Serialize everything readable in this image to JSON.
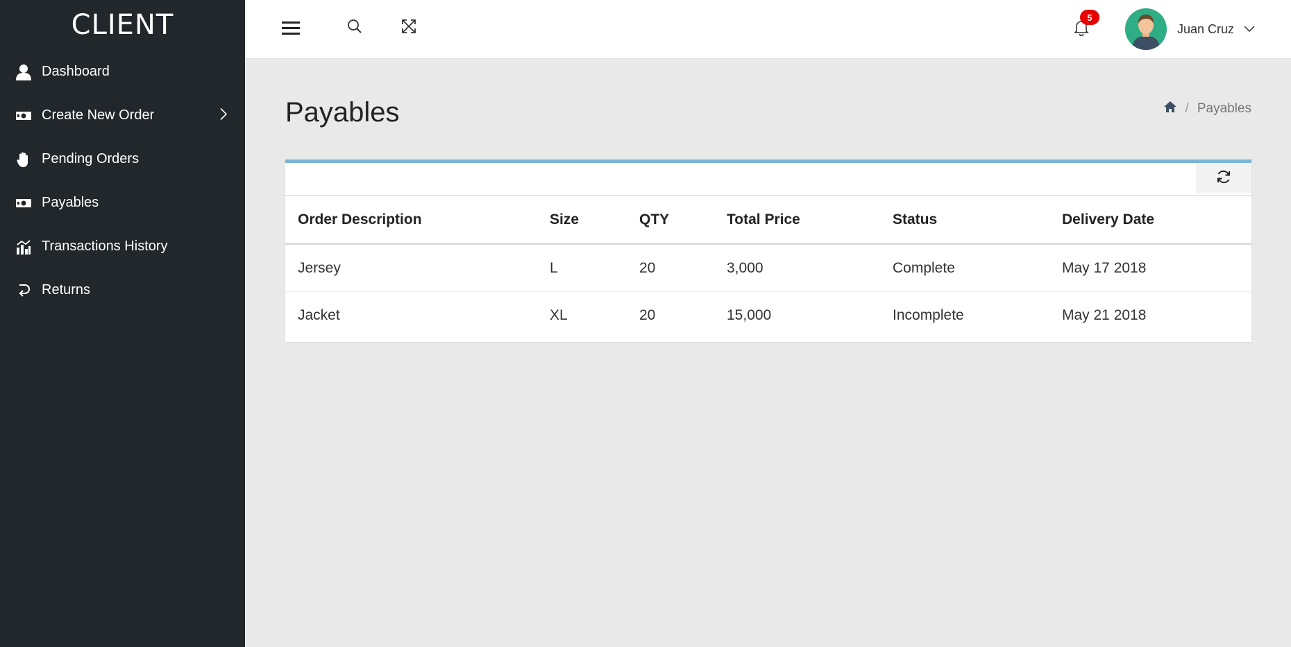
{
  "brand": "CLIENT",
  "sidebar": {
    "items": [
      {
        "label": "Dashboard",
        "icon": "user-icon"
      },
      {
        "label": "Create New Order",
        "icon": "money-icon",
        "has_submenu": true
      },
      {
        "label": "Pending Orders",
        "icon": "hand-icon"
      },
      {
        "label": "Payables",
        "icon": "money-icon"
      },
      {
        "label": "Transactions History",
        "icon": "chart-icon"
      },
      {
        "label": "Returns",
        "icon": "return-icon"
      }
    ]
  },
  "topbar": {
    "notification_count": "5",
    "user_name": "Juan Cruz"
  },
  "page": {
    "title": "Payables",
    "breadcrumb_current": "Payables"
  },
  "table": {
    "headers": [
      "Order Description",
      "Size",
      "QTY",
      "Total Price",
      "Status",
      "Delivery Date"
    ],
    "rows": [
      [
        "Jersey",
        "L",
        "20",
        "3,000",
        "Complete",
        "May 17 2018"
      ],
      [
        "Jacket",
        "XL",
        "20",
        "15,000",
        "Incomplete",
        "May 21 2018"
      ]
    ]
  },
  "colors": {
    "sidebar_bg": "#22272b",
    "content_bg": "#e9e9e9",
    "card_accent": "#7ab4d6",
    "badge": "#e60000",
    "avatar_bg": "#2fae86"
  }
}
